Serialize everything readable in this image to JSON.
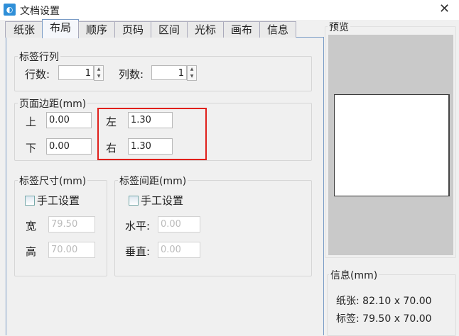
{
  "window": {
    "title": "文档设置",
    "close": "✕"
  },
  "tabs": [
    {
      "label": "纸张"
    },
    {
      "label": "布局"
    },
    {
      "label": "顺序"
    },
    {
      "label": "页码"
    },
    {
      "label": "区间"
    },
    {
      "label": "光标"
    },
    {
      "label": "画布"
    },
    {
      "label": "信息"
    }
  ],
  "rowscols": {
    "title": "标签行列",
    "rows_label": "行数:",
    "rows": "1",
    "cols_label": "列数:",
    "cols": "1"
  },
  "margins": {
    "title": "页面边距(mm)",
    "top_label": "上",
    "top": "0.00",
    "bottom_label": "下",
    "bottom": "0.00",
    "left_label": "左",
    "left": "1.30",
    "right_label": "右",
    "right": "1.30"
  },
  "size": {
    "title": "标签尺寸(mm)",
    "manual": "手工设置",
    "width_label": "宽",
    "width": "79.50",
    "height_label": "高",
    "height": "70.00"
  },
  "gap": {
    "title": "标签间距(mm)",
    "manual": "手工设置",
    "h_label": "水平:",
    "h": "0.00",
    "v_label": "垂直:",
    "v": "0.00"
  },
  "preview": {
    "title": "预览"
  },
  "info": {
    "title": "信息(mm)",
    "paper": "纸张: 82.10 x 70.00",
    "label": "标签: 79.50 x 70.00"
  }
}
